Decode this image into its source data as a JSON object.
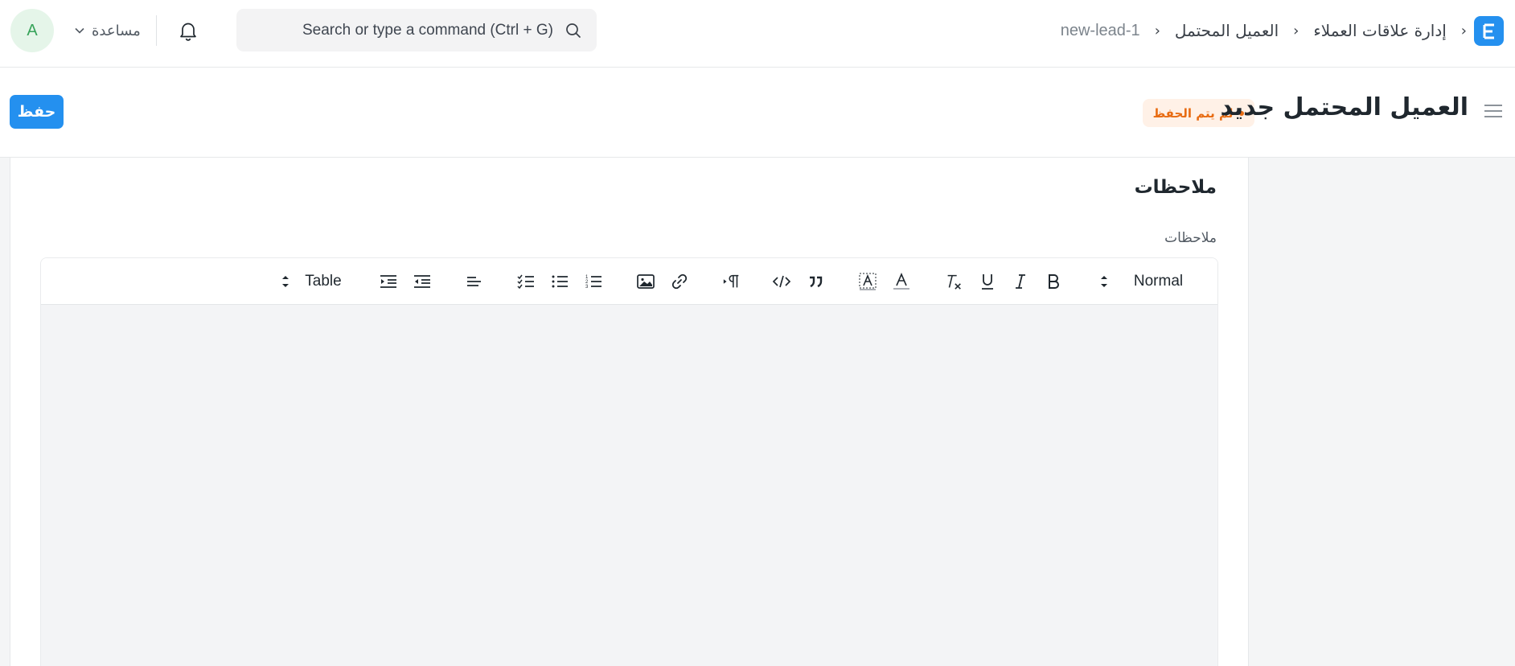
{
  "navbar": {
    "avatar_letter": "A",
    "help_label": "مساعدة",
    "search_placeholder": "Search or type a command (Ctrl + G)",
    "breadcrumbs": [
      "إدارة علاقات العملاء",
      "العميل المحتمل",
      "new-lead-1"
    ]
  },
  "page": {
    "title": "العميل المحتمل جديد",
    "status": "لم يتم الحفظ",
    "save_label": "حفظ"
  },
  "form": {
    "section_title": "ملاحظات",
    "field_label": "ملاحظات"
  },
  "toolbar": {
    "header_select": "Normal",
    "table_label": "Table"
  },
  "colors": {
    "primary": "#2490ef",
    "status_text": "#e86c13",
    "status_bg": "#fff1e7",
    "avatar_bg": "#e5f5e9",
    "avatar_text": "#37a35a"
  }
}
